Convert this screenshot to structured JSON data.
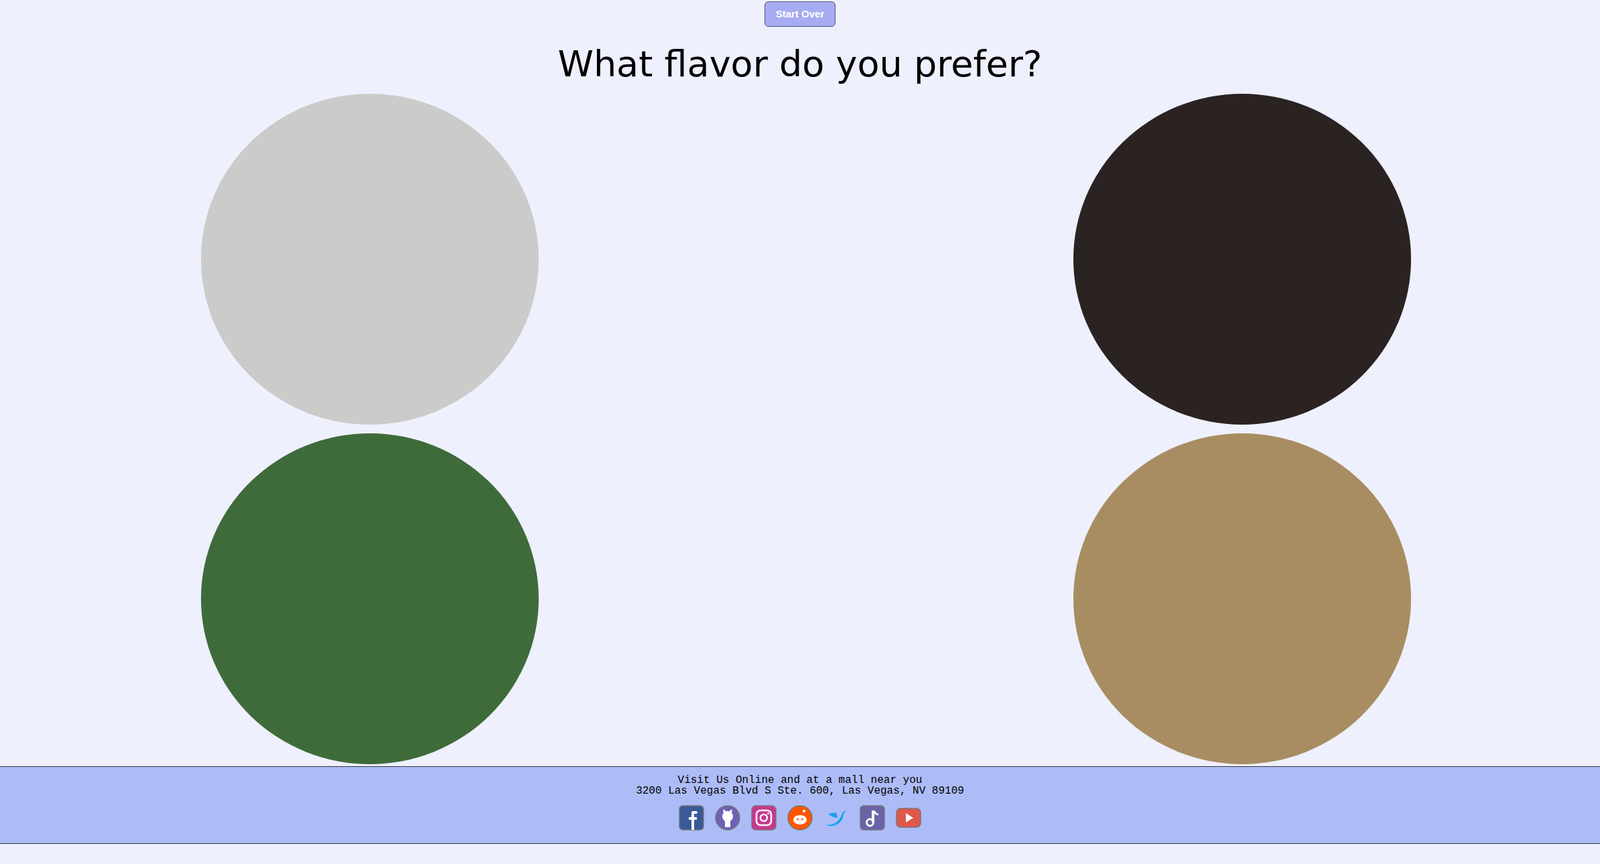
{
  "button": {
    "label": "Start Over"
  },
  "heading": "What flavor do you prefer?",
  "flavors": [
    {
      "color": "#cbcbc9"
    },
    {
      "color": "#2a2322"
    },
    {
      "color": "#3f6b3a"
    },
    {
      "color": "#a88d62"
    }
  ],
  "footer": {
    "lines": [
      "Visit Us Online and at a mall near you",
      "3200 Las Vegas Blvd S Ste. 600, Las Vegas, NV 89109"
    ],
    "social": [
      {
        "color": "#3b5998"
      },
      {
        "color": "#6e62b5"
      },
      {
        "color": "#c8378e"
      },
      {
        "color": "#ff5700"
      },
      {
        "color": "#1da1f2"
      },
      {
        "color": "#6b63a8"
      },
      {
        "color": "#e0574b"
      }
    ]
  }
}
